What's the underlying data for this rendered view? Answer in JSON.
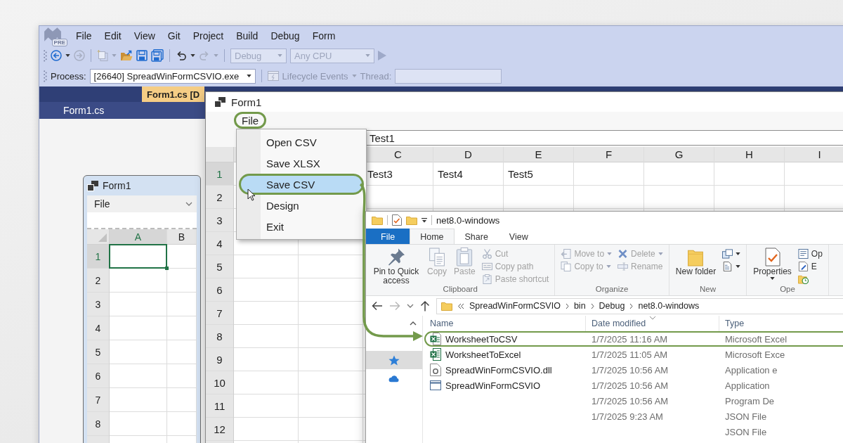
{
  "vs": {
    "logo_badge": "PRE",
    "menu": [
      "File",
      "Edit",
      "View",
      "Git",
      "Project",
      "Build",
      "Debug",
      "Form"
    ],
    "toolbar": {
      "back": {
        "disabled": false
      },
      "forward": {
        "disabled": true
      },
      "new_item": {
        "disabled": true
      },
      "undo": {
        "disabled": false
      },
      "redo": {
        "disabled": true
      },
      "configuration": {
        "value": "Debug",
        "disabled": true
      },
      "platform": {
        "value": "Any CPU",
        "disabled": true
      },
      "start": {
        "disabled": true
      }
    },
    "debug_bar": {
      "process_label": "Process:",
      "process": "[26640] SpreadWinFormCSVIO.exe",
      "lifecycle": {
        "label": "Lifecycle Events",
        "disabled": true
      },
      "thread": {
        "label": "Thread:",
        "disabled": true
      }
    },
    "tabs": [
      {
        "label": "Form1.cs [D",
        "selected": true
      }
    ],
    "lower_tabs": [
      {
        "label": "Form1.cs",
        "selected": false
      }
    ],
    "designer_form": {
      "title": "Form1",
      "menu": [
        "File"
      ],
      "columns": [
        {
          "label": "A",
          "selected": true
        },
        {
          "label": "B",
          "selected": false
        }
      ],
      "rows": [
        {
          "label": "1",
          "selected": true
        },
        {
          "label": "2",
          "selected": false
        },
        {
          "label": "3",
          "selected": false
        },
        {
          "label": "4",
          "selected": false
        },
        {
          "label": "5",
          "selected": false
        },
        {
          "label": "6",
          "selected": false
        },
        {
          "label": "7",
          "selected": false
        },
        {
          "label": "8",
          "selected": false
        }
      ]
    }
  },
  "form_window": {
    "title": "Form1",
    "menu": [
      {
        "label": "File",
        "circled": true
      }
    ],
    "formula_value": "Test1",
    "dropdown": [
      {
        "label": "Open CSV",
        "selected": false,
        "circled": false
      },
      {
        "label": "Save XLSX",
        "selected": false,
        "circled": false
      },
      {
        "label": "Save CSV",
        "selected": true,
        "circled": true
      },
      {
        "label": "Design",
        "selected": false,
        "circled": false
      },
      {
        "label": "Exit",
        "selected": false,
        "circled": false
      }
    ],
    "columns": [
      "C",
      "D",
      "E",
      "F",
      "G",
      "H",
      "I"
    ],
    "rows": [
      {
        "label": "1",
        "selected": true,
        "cells": [
          "Test3",
          "Test4",
          "Test5"
        ]
      },
      {
        "label": "2",
        "selected": false
      },
      {
        "label": "3",
        "selected": false
      },
      {
        "label": "4",
        "selected": false
      },
      {
        "label": "5",
        "selected": false
      },
      {
        "label": "6",
        "selected": false
      },
      {
        "label": "7",
        "selected": false
      },
      {
        "label": "8",
        "selected": false
      },
      {
        "label": "9",
        "selected": false
      },
      {
        "label": "10",
        "selected": false
      },
      {
        "label": "11",
        "selected": false
      },
      {
        "label": "12",
        "selected": false
      }
    ]
  },
  "explorer": {
    "title": "net8.0-windows",
    "tabs": [
      {
        "label": "File",
        "kind": "file",
        "selected": false
      },
      {
        "label": "Home",
        "kind": "tab",
        "selected": true
      },
      {
        "label": "Share",
        "kind": "tab",
        "selected": false
      },
      {
        "label": "View",
        "kind": "tab",
        "selected": false
      }
    ],
    "ribbon": [
      {
        "label": "Clipboard",
        "buttons": [
          {
            "label": "Pin to Quick access",
            "kind": "large",
            "disabled": false
          },
          {
            "label": "Copy",
            "kind": "large",
            "disabled": true
          },
          {
            "label": "Paste",
            "kind": "large",
            "disabled": true
          },
          {
            "label": "Cut",
            "kind": "small",
            "disabled": true
          },
          {
            "label": "Copy path",
            "kind": "small",
            "disabled": true
          },
          {
            "label": "Paste shortcut",
            "kind": "small",
            "disabled": true
          }
        ]
      },
      {
        "label": "Organize",
        "buttons": [
          {
            "label": "Move to",
            "kind": "small",
            "disabled": true,
            "menu": true
          },
          {
            "label": "Copy to",
            "kind": "small",
            "disabled": true,
            "menu": true
          },
          {
            "label": "Delete",
            "kind": "small",
            "disabled": true,
            "menu": true
          },
          {
            "label": "Rename",
            "kind": "small",
            "disabled": true,
            "menu": false
          }
        ]
      },
      {
        "label": "New",
        "buttons": [
          {
            "label": "New folder",
            "kind": "large",
            "disabled": false,
            "menu": false
          },
          {
            "kind": "icon",
            "disabled": false,
            "menu": true
          },
          {
            "kind": "icon",
            "disabled": false,
            "menu": true
          }
        ]
      },
      {
        "label": "Ope",
        "buttons": [
          {
            "label": "Properties",
            "kind": "large",
            "disabled": false,
            "menu": true
          },
          {
            "label": "Op",
            "kind": "small",
            "disabled": false,
            "menu": false
          },
          {
            "label": "E",
            "kind": "small",
            "disabled": false,
            "menu": false
          },
          {
            "kind": "icon",
            "disabled": false,
            "menu": false
          }
        ]
      }
    ],
    "address": {
      "back": {
        "disabled": false
      },
      "forward": {
        "disabled": true
      },
      "path": [
        "SpreadWinFormCSVIO",
        "bin",
        "Debug",
        "net8.0-windows"
      ]
    },
    "nav": [
      {
        "selected": true
      },
      {
        "selected": false
      }
    ],
    "columns": [
      {
        "label": "Name",
        "sorted": false
      },
      {
        "label": "Date modified",
        "sorted": true
      },
      {
        "label": "Type",
        "sorted": false
      }
    ],
    "files": [
      {
        "name": "WorksheetToCSV",
        "kind": "csv",
        "date": "1/7/2025 11:16 AM",
        "type": "Microsoft Excel",
        "circled": true
      },
      {
        "name": "WorksheetToExcel",
        "kind": "xlsx",
        "date": "1/7/2025 11:05 AM",
        "type": "Microsoft Exce",
        "circled": false
      },
      {
        "name": "SpreadWinFormCSVIO.dll",
        "kind": "dll",
        "date": "1/7/2025 10:56 AM",
        "type": "Application e",
        "circled": false
      },
      {
        "name": "SpreadWinFormCSVIO",
        "kind": "exe",
        "date": "1/7/2025 10:56 AM",
        "type": "Application",
        "circled": false
      },
      {
        "date": "1/7/2025 10:56 AM",
        "type": "Program De",
        "circled": false
      },
      {
        "date": "1/7/2025 9:23 AM",
        "type": "JSON File",
        "circled": false
      },
      {
        "type": "JSON File",
        "circled": false
      }
    ]
  }
}
